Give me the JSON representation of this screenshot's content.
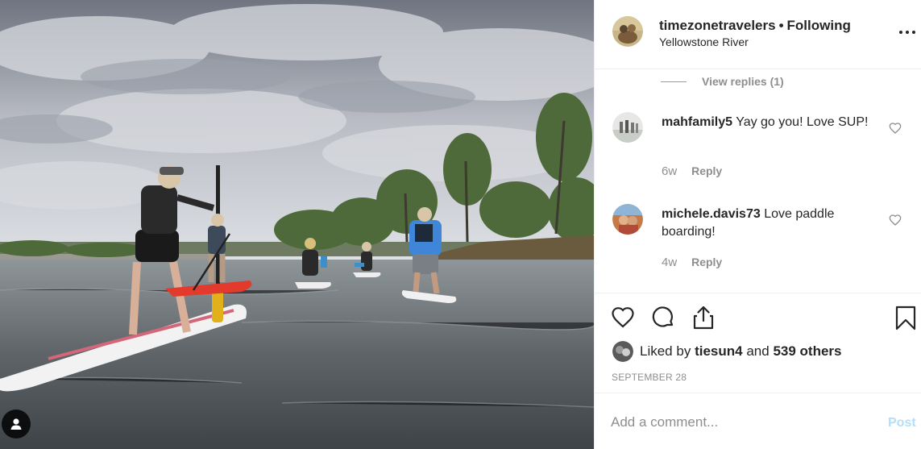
{
  "post": {
    "username": "timezonetravelers",
    "separator": "•",
    "follow_status": "Following",
    "location": "Yellowstone River",
    "photo_description": "Paddle boarders on the Yellowstone River",
    "tag_icon": "person-icon"
  },
  "replies_toggle": "View replies (1)",
  "comments": [
    {
      "username": "mahfamily5",
      "text": "Yay go you! Love SUP!",
      "time": "6w",
      "reply": "Reply"
    },
    {
      "username": "michele.davis73",
      "text": "Love paddle boarding!",
      "time": "4w",
      "reply": "Reply"
    }
  ],
  "actions": {
    "like_icon": "heart-icon",
    "comment_icon": "comment-icon",
    "share_icon": "share-icon",
    "save_icon": "bookmark-icon"
  },
  "likes": {
    "prefix": "Liked by",
    "user": "tiesun4",
    "and": "and",
    "others": "539 others"
  },
  "date": "SEPTEMBER 28",
  "comment_box": {
    "placeholder": "Add a comment...",
    "post_label": "Post"
  },
  "colors": {
    "post_disabled": "#b2dffc",
    "muted_text": "#8e8e8e",
    "primary_text": "#262626"
  }
}
